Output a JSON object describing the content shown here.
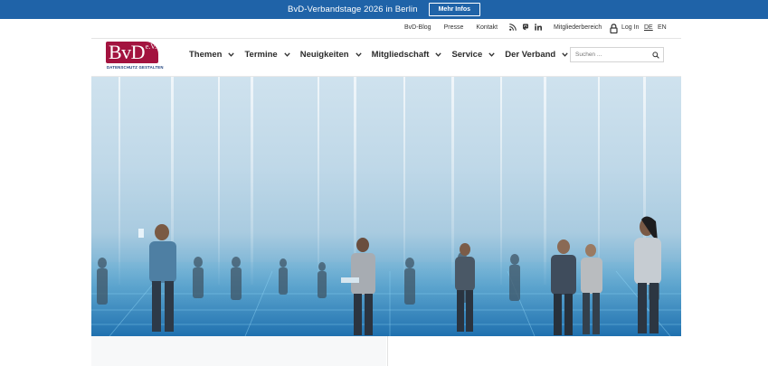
{
  "announcement": {
    "text": "BvD-Verbandstage 2026 in Berlin",
    "button": "Mehr Infos"
  },
  "utility": {
    "links": [
      "BvD-Blog",
      "Presse",
      "Kontakt"
    ],
    "social_icons": [
      "rss-icon",
      "mastodon-icon",
      "linkedin-icon"
    ],
    "member_area": "Mitgliederbereich",
    "login": "Log In",
    "lang_de": "DE",
    "lang_en": "EN"
  },
  "logo": {
    "text": "BvD",
    "superscript": "e.V.",
    "tagline": "DATENSCHUTZ GESTALTEN"
  },
  "nav": [
    "Themen",
    "Termine",
    "Neuigkeiten",
    "Mitgliedschaft",
    "Service",
    "Der Verband"
  ],
  "search": {
    "placeholder": "Suchen ..."
  },
  "colors": {
    "brand_blue": "#1f63a8",
    "brand_red": "#a3133f"
  }
}
